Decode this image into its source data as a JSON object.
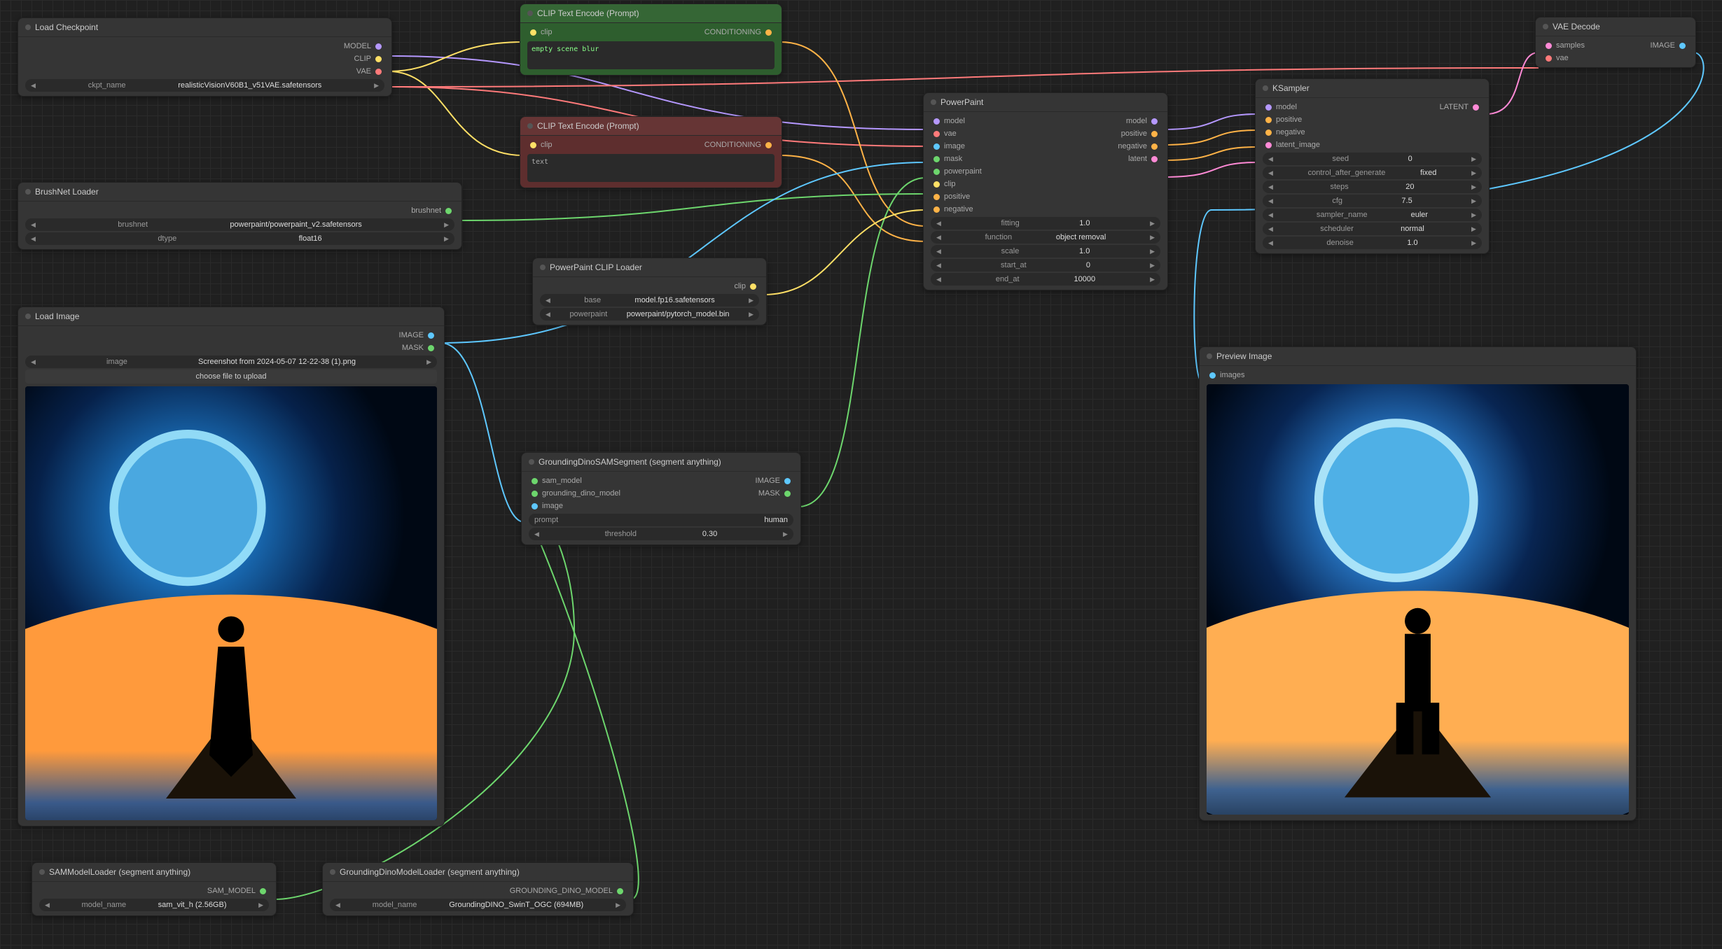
{
  "nodes": {
    "load_checkpoint": {
      "title": "Load Checkpoint",
      "outputs": [
        "MODEL",
        "CLIP",
        "VAE"
      ],
      "widgets": [
        {
          "name": "ckpt_name",
          "value": "realisticVisionV60B1_v51VAE.safetensors"
        }
      ]
    },
    "brushnet_loader": {
      "title": "BrushNet Loader",
      "outputs": [
        "brushnet"
      ],
      "widgets": [
        {
          "name": "brushnet",
          "value": "powerpaint/powerpaint_v2.safetensors"
        },
        {
          "name": "dtype",
          "value": "float16"
        }
      ]
    },
    "load_image": {
      "title": "Load Image",
      "outputs": [
        "IMAGE",
        "MASK"
      ],
      "widgets": [
        {
          "name": "image",
          "value": "Screenshot from 2024-05-07 12-22-38 (1).png"
        }
      ],
      "button": "choose file to upload"
    },
    "clip_encode_pos": {
      "title": "CLIP Text Encode (Prompt)",
      "inputs": [
        "clip"
      ],
      "outputs": [
        "CONDITIONING"
      ],
      "text": "empty scene blur"
    },
    "clip_encode_neg": {
      "title": "CLIP Text Encode (Prompt)",
      "inputs": [
        "clip"
      ],
      "outputs": [
        "CONDITIONING"
      ],
      "text": "text"
    },
    "powerpaint_clip": {
      "title": "PowerPaint CLIP Loader",
      "outputs": [
        "clip"
      ],
      "widgets": [
        {
          "name": "base",
          "value": "model.fp16.safetensors"
        },
        {
          "name": "powerpaint",
          "value": "powerpaint/pytorch_model.bin"
        }
      ]
    },
    "grounding_sam": {
      "title": "GroundingDinoSAMSegment (segment anything)",
      "inputs": [
        "sam_model",
        "grounding_dino_model",
        "image"
      ],
      "outputs": [
        "IMAGE",
        "MASK"
      ],
      "widgets": [
        {
          "name": "prompt",
          "value": "human"
        },
        {
          "name": "threshold",
          "value": "0.30"
        }
      ]
    },
    "sam_loader": {
      "title": "SAMModelLoader (segment anything)",
      "outputs": [
        "SAM_MODEL"
      ],
      "widgets": [
        {
          "name": "model_name",
          "value": "sam_vit_h (2.56GB)"
        }
      ]
    },
    "dino_loader": {
      "title": "GroundingDinoModelLoader (segment anything)",
      "outputs": [
        "GROUNDING_DINO_MODEL"
      ],
      "widgets": [
        {
          "name": "model_name",
          "value": "GroundingDINO_SwinT_OGC (694MB)"
        }
      ]
    },
    "powerpaint": {
      "title": "PowerPaint",
      "inputs": [
        "model",
        "vae",
        "image",
        "mask",
        "powerpaint",
        "clip",
        "positive",
        "negative"
      ],
      "outputs": [
        "model",
        "positive",
        "negative",
        "latent"
      ],
      "widgets": [
        {
          "name": "fitting",
          "value": "1.0"
        },
        {
          "name": "function",
          "value": "object removal"
        },
        {
          "name": "scale",
          "value": "1.0"
        },
        {
          "name": "start_at",
          "value": "0"
        },
        {
          "name": "end_at",
          "value": "10000"
        }
      ]
    },
    "ksampler": {
      "title": "KSampler",
      "inputs": [
        "model",
        "positive",
        "negative",
        "latent_image"
      ],
      "outputs": [
        "LATENT"
      ],
      "widgets": [
        {
          "name": "seed",
          "value": "0"
        },
        {
          "name": "control_after_generate",
          "value": "fixed"
        },
        {
          "name": "steps",
          "value": "20"
        },
        {
          "name": "cfg",
          "value": "7.5"
        },
        {
          "name": "sampler_name",
          "value": "euler"
        },
        {
          "name": "scheduler",
          "value": "normal"
        },
        {
          "name": "denoise",
          "value": "1.0"
        }
      ]
    },
    "vae_decode": {
      "title": "VAE Decode",
      "inputs": [
        "samples",
        "vae"
      ],
      "outputs": [
        "IMAGE"
      ]
    },
    "preview": {
      "title": "Preview Image",
      "inputs": [
        "images"
      ]
    }
  },
  "colors": {
    "model": "#b598ff",
    "clip": "#ffe066",
    "vae": "#ff7a7a",
    "conditioning": "#ffb347",
    "image": "#5ec8ff",
    "mask": "#6dd66d",
    "latent": "#ff8ad6",
    "brushnet": "#6dd66d",
    "sam": "#6dd66d",
    "dino": "#6dd66d"
  }
}
